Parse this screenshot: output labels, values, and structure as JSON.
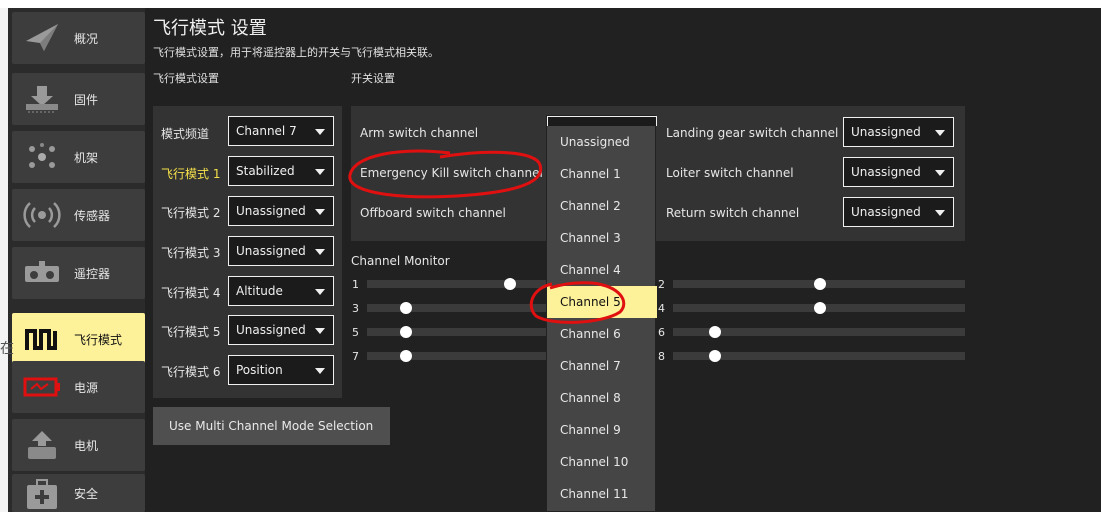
{
  "sidebar": {
    "items": [
      {
        "label": "概况",
        "icon": "paper-plane-icon"
      },
      {
        "label": "固件",
        "icon": "download-icon"
      },
      {
        "label": "机架",
        "icon": "airframe-icon"
      },
      {
        "label": "传感器",
        "icon": "radio-waves-icon"
      },
      {
        "label": "遥控器",
        "icon": "remote-control-icon"
      },
      {
        "label": "飞行模式",
        "icon": "flight-mode-wave-icon",
        "active": true
      },
      {
        "label": "电源",
        "icon": "battery-icon"
      },
      {
        "label": "电机",
        "icon": "motor-icon"
      },
      {
        "label": "安全",
        "icon": "first-aid-icon"
      }
    ]
  },
  "header": {
    "title": "飞行模式 设置",
    "subtitle": "飞行模式设置，用于将遥控器上的开关与飞行模式相关联。",
    "flight_section": "飞行模式设置",
    "switch_section": "开关设置"
  },
  "flight_modes": {
    "mode_channel_label": "模式频道",
    "mode_channel_value": "Channel 7",
    "modes": [
      {
        "label": "飞行模式 1",
        "value": "Stabilized"
      },
      {
        "label": "飞行模式 2",
        "value": "Unassigned"
      },
      {
        "label": "飞行模式 3",
        "value": "Unassigned"
      },
      {
        "label": "飞行模式 4",
        "value": "Altitude"
      },
      {
        "label": "飞行模式 5",
        "value": "Unassigned"
      },
      {
        "label": "飞行模式 6",
        "value": "Position"
      }
    ],
    "multi_button": "Use Multi Channel Mode Selection"
  },
  "switches": {
    "arm": "Arm switch channel",
    "kill": "Emergency Kill switch channel",
    "offboard": "Offboard switch channel",
    "landing": "Landing gear switch channel",
    "landing_value": "Unassigned",
    "loiter": "Loiter switch channel",
    "loiter_value": "Unassigned",
    "return": "Return switch channel",
    "return_value": "Unassigned"
  },
  "monitor": {
    "title": "Channel Monitor",
    "channels": [
      "1",
      "2",
      "3",
      "4",
      "5",
      "6",
      "7",
      "8"
    ]
  },
  "dropdown": {
    "options": [
      "Unassigned",
      "Channel 1",
      "Channel 2",
      "Channel 3",
      "Channel 4",
      "Channel 5",
      "Channel 6",
      "Channel 7",
      "Channel 8",
      "Channel 9",
      "Channel 10",
      "Channel 11"
    ],
    "selected": "Channel 5"
  },
  "colors": {
    "active": "#fdf19a",
    "annotation": "#e01010",
    "mode1_label": "#f5e04a"
  }
}
